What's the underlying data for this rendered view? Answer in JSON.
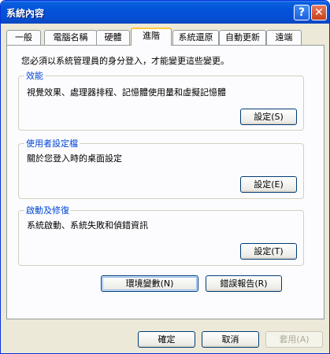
{
  "window": {
    "title": "系統內容"
  },
  "titlebar": {
    "help_glyph": "?",
    "close_glyph": "✕"
  },
  "tabs": [
    {
      "label": "一般"
    },
    {
      "label": "電腦名稱"
    },
    {
      "label": "硬體"
    },
    {
      "label": "進階",
      "active": true
    },
    {
      "label": "系統還原"
    },
    {
      "label": "自動更新"
    },
    {
      "label": "遠端"
    }
  ],
  "intro_text": "您必須以系統管理員的身分登入，才能變更這些變更。",
  "groups": {
    "performance": {
      "title": "效能",
      "description": "視覺效果、處理器排程、記憶體使用量和虛擬記憶體",
      "button": "設定(S)"
    },
    "user_profiles": {
      "title": "使用者設定檔",
      "description": "關於您登入時的桌面設定",
      "button": "設定(E)"
    },
    "startup_recovery": {
      "title": "啟動及修復",
      "description": "系統啟動、系統失敗和偵錯資訊",
      "button": "設定(T)"
    }
  },
  "buttons": {
    "env_vars": "環境變數(N)",
    "error_report": "錯誤報告(R)",
    "ok": "確定",
    "cancel": "取消",
    "apply": "套用(A)"
  },
  "colors": {
    "titlebar": "#0353d8",
    "group_title": "#0046d5",
    "active_tab_accent": "#ffc83c",
    "dialog_bg": "#ece9d8"
  }
}
